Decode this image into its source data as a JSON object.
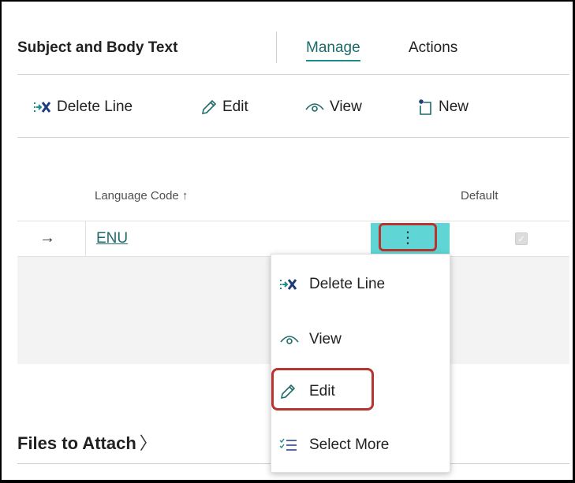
{
  "page": {
    "title": "Subject and Body Text"
  },
  "header_tabs": [
    {
      "label": "Manage"
    },
    {
      "label": "Actions"
    }
  ],
  "toolbar": {
    "delete_line": "Delete Line",
    "edit": "Edit",
    "view": "View",
    "new": "New"
  },
  "table": {
    "columns": [
      {
        "label": "Language Code ↑"
      },
      {
        "label": "Default"
      }
    ],
    "rows": [
      {
        "arrow": "→",
        "language_code": "ENU",
        "menu": "⋮",
        "default": true
      }
    ]
  },
  "context_menu": {
    "items": [
      {
        "label": "Delete Line",
        "icon": "delete-line-icon"
      },
      {
        "label": "View",
        "icon": "view-icon"
      },
      {
        "label": "Edit",
        "icon": "pencil-icon"
      },
      {
        "label": "Select More",
        "icon": "select-more-icon"
      }
    ]
  },
  "files_section": {
    "title": "Files to Attach",
    "chevron": "〉"
  },
  "colors": {
    "accent": "#1d8c8c",
    "highlight": "#5fd5d5",
    "annotation": "#b9342f"
  }
}
